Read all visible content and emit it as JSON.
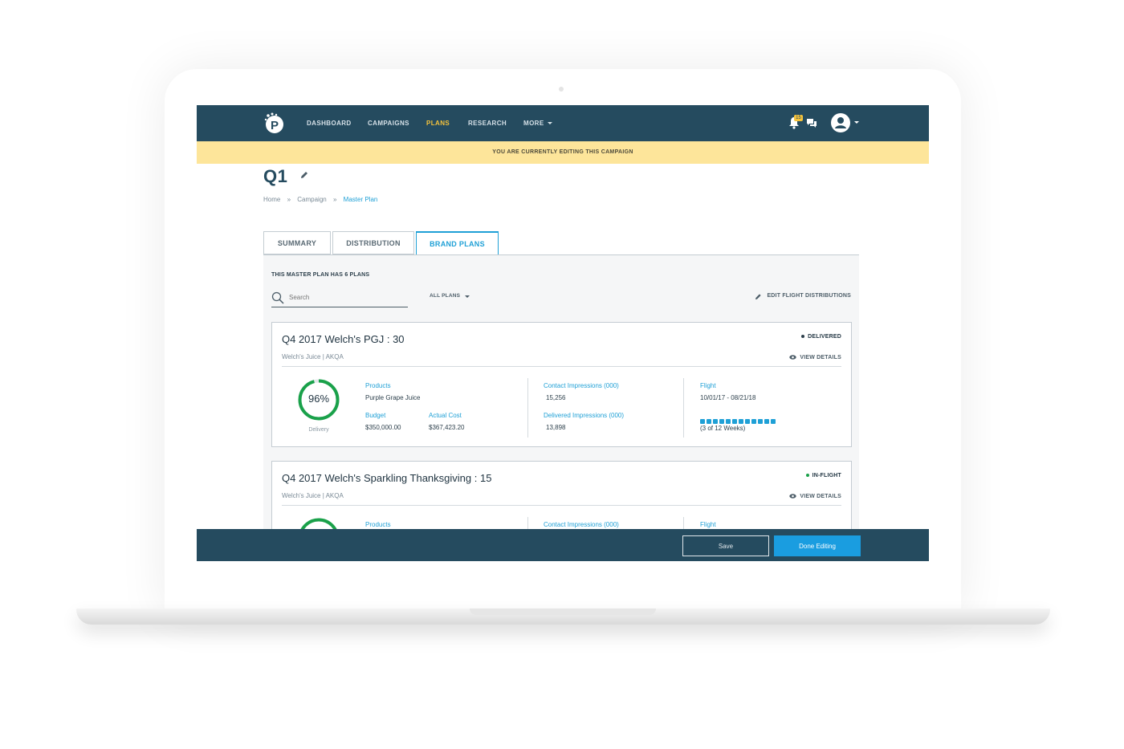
{
  "nav": {
    "items": [
      "DASHBOARD",
      "CAMPAIGNS",
      "PLANS",
      "RESEARCH",
      "MORE"
    ],
    "active": "PLANS",
    "notifications_count": "15"
  },
  "banner": "YOU ARE CURRENTLY EDITING THIS CAMPAIGN",
  "page": {
    "title": "Q1",
    "breadcrumb": [
      "Home",
      "Campaign",
      "Master Plan"
    ],
    "breadcrumb_sep": "»"
  },
  "tabs": [
    "SUMMARY",
    "DISTRIBUTION",
    "BRAND PLANS"
  ],
  "panel": {
    "plan_count": "THIS MASTER PLAN HAS 6 PLANS",
    "search_placeholder": "Search",
    "filter": "ALL PLANS",
    "edit_flight": "EDIT FLIGHT DISTRIBUTIONS"
  },
  "cards": [
    {
      "title": "Q4 2017 Welch's PGJ : 30",
      "sub": "Welch's Juice  |  AKQA",
      "status": "DELIVERED",
      "status_color": "#2c3f4b",
      "view": "VIEW DETAILS",
      "delivery_pct": "96%",
      "delivery_fraction": 0.96,
      "delivery_caption": "Delivery",
      "products_label": "Products",
      "products": "Purple Grape Juice",
      "budget_label": "Budget",
      "budget": "$350,000.00",
      "actual_label": "Actual Cost",
      "actual": "$367,423.20",
      "contact_label": "Contact Impressions (000)",
      "contact": "15,256",
      "delivered_label": "Delivered Impressions (000)",
      "delivered": "13,898",
      "flight_label": "Flight",
      "flight": "10/01/17 - 08/21/18",
      "weeks_text": "(3 of 12 Weeks)",
      "weeks_total": 12
    },
    {
      "title": "Q4 2017 Welch's Sparkling Thanksgiving : 15",
      "sub": "Welch's Juice  |  AKQA",
      "status": "IN-FLIGHT",
      "status_color": "#1aa14a",
      "view": "VIEW DETAILS",
      "products_label": "Products",
      "contact_label": "Contact Impressions (000)",
      "flight_label": "Flight"
    }
  ],
  "footer": {
    "save": "Save",
    "done": "Done Editing"
  },
  "colors": {
    "navy": "#254b5f",
    "accent": "#1fa0d6",
    "banner": "#fde59a",
    "active_nav": "#f5c33c",
    "ring_green": "#1aa14a"
  }
}
